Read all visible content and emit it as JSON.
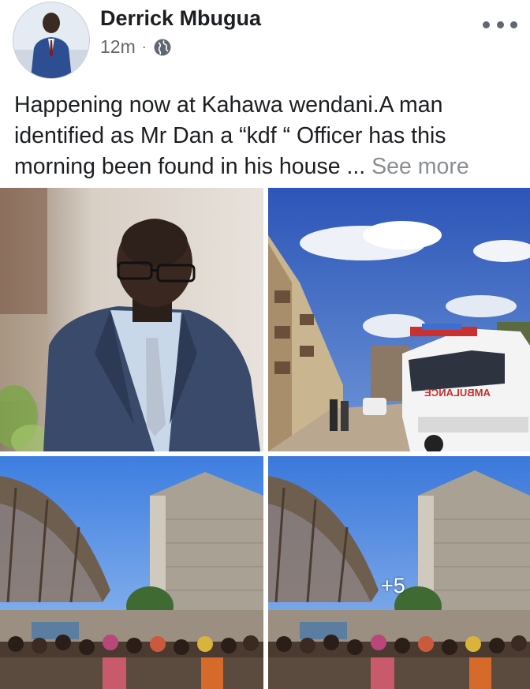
{
  "post": {
    "author_name": "Derrick Mbugua",
    "timestamp": "12m",
    "separator": "·",
    "audience_icon": "globe-icon",
    "text": "Happening now at Kahawa wendani.A man identified as Mr Dan a “kdf “ Officer has this morning been found in his house ... ",
    "see_more_label": "See more"
  },
  "photos": {
    "extra_count_label": "+5",
    "ambulance_text": "AMBULANCE"
  },
  "colors": {
    "text_primary": "#1c1e21",
    "text_secondary": "#65676b",
    "see_more": "#8a8d91"
  }
}
